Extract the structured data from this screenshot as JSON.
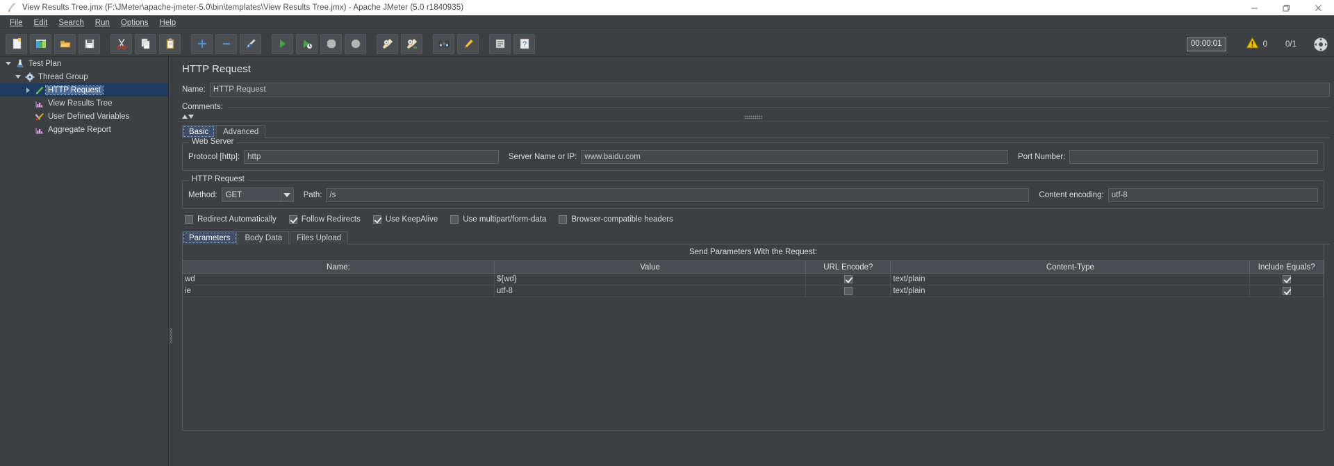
{
  "window": {
    "title": "View Results Tree.jmx (F:\\JMeter\\apache-jmeter-5.0\\bin\\templates\\View Results Tree.jmx) - Apache JMeter (5.0 r1840935)",
    "app_icon": "jmeter-feather-icon",
    "controls": {
      "minimize": "minimize-icon",
      "maximize": "maximize-icon",
      "close": "close-icon"
    }
  },
  "menubar": {
    "items": [
      {
        "label": "File",
        "mnemonic": "F"
      },
      {
        "label": "Edit",
        "mnemonic": "E"
      },
      {
        "label": "Search",
        "mnemonic": "S"
      },
      {
        "label": "Run",
        "mnemonic": "R"
      },
      {
        "label": "Options",
        "mnemonic": "O"
      },
      {
        "label": "Help",
        "mnemonic": "H"
      }
    ]
  },
  "toolbar": {
    "buttons": [
      {
        "name": "new-button",
        "icon": "new-document-icon"
      },
      {
        "name": "templates-button",
        "icon": "templates-icon"
      },
      {
        "name": "open-button",
        "icon": "open-folder-icon"
      },
      {
        "name": "save-button",
        "icon": "save-disk-icon"
      },
      {
        "name": "cut-button",
        "icon": "scissors-icon"
      },
      {
        "name": "copy-button",
        "icon": "copy-pages-icon"
      },
      {
        "name": "paste-button",
        "icon": "clipboard-icon"
      },
      {
        "name": "expand-all-button",
        "icon": "plus-icon"
      },
      {
        "name": "collapse-all-button",
        "icon": "minus-icon"
      },
      {
        "name": "toggle-button",
        "icon": "toggle-pencil-icon"
      },
      {
        "name": "start-button",
        "icon": "green-play-icon"
      },
      {
        "name": "start-no-pauses-button",
        "icon": "green-play-nopause-icon"
      },
      {
        "name": "stop-button",
        "icon": "stop-gray-icon"
      },
      {
        "name": "shutdown-button",
        "icon": "shutdown-gray-icon"
      },
      {
        "name": "clear-button",
        "icon": "clear-broom-icon"
      },
      {
        "name": "clear-all-button",
        "icon": "clear-all-broom-icon"
      },
      {
        "name": "search-button",
        "icon": "binoculars-icon"
      },
      {
        "name": "reset-search-button",
        "icon": "reset-search-icon"
      },
      {
        "name": "function-helper-button",
        "icon": "function-helper-icon"
      },
      {
        "name": "help-button",
        "icon": "help-question-icon"
      }
    ],
    "timer": "00:00:01",
    "warning_icon": "warning-triangle-icon",
    "warning_count": "0",
    "thread_count": "0/1",
    "remote_icon": "remote-connection-icon"
  },
  "tree": {
    "nodes": [
      {
        "label": "Test Plan",
        "icon": "test-plan-icon",
        "indent": 0,
        "twisty": "down",
        "selected": false
      },
      {
        "label": "Thread Group",
        "icon": "thread-group-gear-icon",
        "indent": 1,
        "twisty": "down",
        "selected": false
      },
      {
        "label": "HTTP Request",
        "icon": "http-request-pencil-icon",
        "indent": 2,
        "twisty": "right",
        "selected": true
      },
      {
        "label": "View Results Tree",
        "icon": "view-results-tree-icon",
        "indent": 2,
        "twisty": "none",
        "selected": false
      },
      {
        "label": "User Defined Variables",
        "icon": "user-defined-variables-icon",
        "indent": 2,
        "twisty": "none",
        "selected": false
      },
      {
        "label": "Aggregate Report",
        "icon": "aggregate-report-icon",
        "indent": 2,
        "twisty": "none",
        "selected": false
      }
    ]
  },
  "main": {
    "panel_title": "HTTP Request",
    "name_label": "Name:",
    "name_value": "HTTP Request",
    "comments_label": "Comments:",
    "comments_value": "",
    "tabs": [
      {
        "label": "Basic",
        "active": true
      },
      {
        "label": "Advanced",
        "active": false
      }
    ],
    "web_server": {
      "group_title": "Web Server",
      "protocol_label": "Protocol [http]:",
      "protocol_value": "http",
      "server_label": "Server Name or IP:",
      "server_value": "www.baidu.com",
      "port_label": "Port Number:",
      "port_value": ""
    },
    "http_request": {
      "group_title": "HTTP Request",
      "method_label": "Method:",
      "method_value": "GET",
      "path_label": "Path:",
      "path_value": "/s",
      "content_encoding_label": "Content encoding:",
      "content_encoding_value": "utf-8"
    },
    "options": [
      {
        "label": "Redirect Automatically",
        "checked": false
      },
      {
        "label": "Follow Redirects",
        "checked": true
      },
      {
        "label": "Use KeepAlive",
        "checked": true
      },
      {
        "label": "Use multipart/form-data",
        "checked": false
      },
      {
        "label": "Browser-compatible headers",
        "checked": false
      }
    ],
    "param_tabs": [
      {
        "label": "Parameters",
        "active": true
      },
      {
        "label": "Body Data",
        "active": false
      },
      {
        "label": "Files Upload",
        "active": false
      }
    ],
    "params_table": {
      "caption": "Send Parameters With the Request:",
      "columns": [
        "Name:",
        "Value",
        "URL Encode?",
        "Content-Type",
        "Include Equals?"
      ],
      "rows": [
        {
          "name": "wd",
          "value": "${wd}",
          "url_encode": true,
          "content_type": "text/plain",
          "include_equals": true
        },
        {
          "name": "ie",
          "value": "utf-8",
          "url_encode": false,
          "content_type": "text/plain",
          "include_equals": true
        }
      ]
    }
  },
  "colors": {
    "background": "#3c4043",
    "selection": "#4a6a96",
    "tab_active": "#3f4e68",
    "text": "#dcdcdc",
    "warning": "#f2c200",
    "run_green": "#3faa35"
  }
}
